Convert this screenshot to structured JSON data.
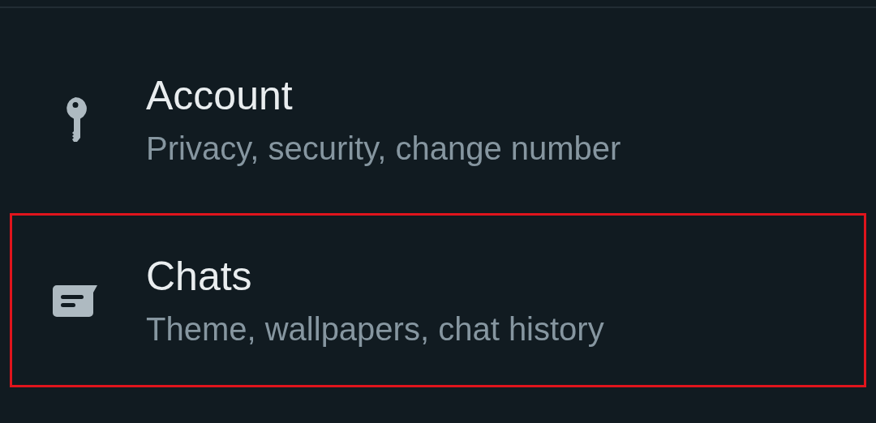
{
  "settings": [
    {
      "kind": "key",
      "title": "Account",
      "subtitle": "Privacy, security, change number",
      "highlighted": false
    },
    {
      "kind": "chat",
      "title": "Chats",
      "subtitle": "Theme, wallpapers, chat history",
      "highlighted": true
    }
  ]
}
